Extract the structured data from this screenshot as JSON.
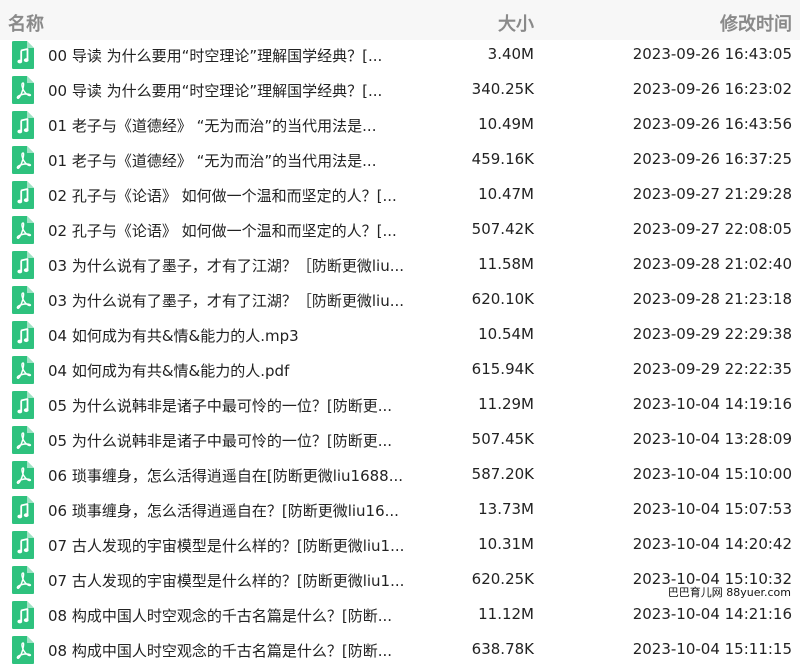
{
  "header": {
    "name_label": "名称",
    "size_label": "大小",
    "time_label": "修改时间"
  },
  "icon_color": "#2ec27e",
  "files": [
    {
      "name": "00 导读 为什么要用“时空理论”理解国学经典？[...",
      "size": "3.40M",
      "time": "2023-09-26 16:43:05",
      "type": "audio",
      "icon": "music-note-icon"
    },
    {
      "name": "00 导读 为什么要用“时空理论”理解国学经典？[...",
      "size": "340.25K",
      "time": "2023-09-26 16:23:02",
      "type": "pdf",
      "icon": "pdf-icon"
    },
    {
      "name": "01 老子与《道德经》 “无为而治”的当代用法是...",
      "size": "10.49M",
      "time": "2023-09-26 16:43:56",
      "type": "audio",
      "icon": "music-note-icon"
    },
    {
      "name": "01 老子与《道德经》 “无为而治”的当代用法是...",
      "size": "459.16K",
      "time": "2023-09-26 16:37:25",
      "type": "pdf",
      "icon": "pdf-icon"
    },
    {
      "name": "02 孔子与《论语》 如何做一个温和而坚定的人？[...",
      "size": "10.47M",
      "time": "2023-09-27 21:29:28",
      "type": "audio",
      "icon": "music-note-icon"
    },
    {
      "name": "02 孔子与《论语》 如何做一个温和而坚定的人？[...",
      "size": "507.42K",
      "time": "2023-09-27 22:08:05",
      "type": "pdf",
      "icon": "pdf-icon"
    },
    {
      "name": "03 为什么说有了墨子，才有了江湖？［防断更微liu...",
      "size": "11.58M",
      "time": "2023-09-28 21:02:40",
      "type": "audio",
      "icon": "music-note-icon"
    },
    {
      "name": "03 为什么说有了墨子，才有了江湖？［防断更微liu...",
      "size": "620.10K",
      "time": "2023-09-28 21:23:18",
      "type": "pdf",
      "icon": "pdf-icon"
    },
    {
      "name": "04 如何成为有共&情&能力的人.mp3",
      "size": "10.54M",
      "time": "2023-09-29 22:29:38",
      "type": "audio",
      "icon": "music-note-icon"
    },
    {
      "name": "04 如何成为有共&情&能力的人.pdf",
      "size": "615.94K",
      "time": "2023-09-29 22:22:35",
      "type": "pdf",
      "icon": "pdf-icon"
    },
    {
      "name": "05 为什么说韩非是诸子中最可怜的一位？[防断更...",
      "size": "11.29M",
      "time": "2023-10-04 14:19:16",
      "type": "audio",
      "icon": "music-note-icon"
    },
    {
      "name": "05 为什么说韩非是诸子中最可怜的一位？[防断更...",
      "size": "507.45K",
      "time": "2023-10-04 13:28:09",
      "type": "pdf",
      "icon": "pdf-icon"
    },
    {
      "name": "06 琐事缠身，怎么活得逍遥自在[防断更微liu1688...",
      "size": "587.20K",
      "time": "2023-10-04 15:10:00",
      "type": "pdf",
      "icon": "pdf-icon"
    },
    {
      "name": "06 琐事缠身，怎么活得逍遥自在？[防断更微liu16...",
      "size": "13.73M",
      "time": "2023-10-04 15:07:53",
      "type": "audio",
      "icon": "music-note-icon"
    },
    {
      "name": "07 古人发现的宇宙模型是什么样的？[防断更微liu1...",
      "size": "10.31M",
      "time": "2023-10-04 14:20:42",
      "type": "audio",
      "icon": "music-note-icon"
    },
    {
      "name": "07 古人发现的宇宙模型是什么样的？[防断更微liu1...",
      "size": "620.25K",
      "time": "2023-10-04 15:10:32",
      "type": "pdf",
      "icon": "pdf-icon"
    },
    {
      "name": "08 构成中国人时空观念的千古名篇是什么？[防断...",
      "size": "11.12M",
      "time": "2023-10-04 14:21:16",
      "type": "audio",
      "icon": "music-note-icon"
    },
    {
      "name": "08 构成中国人时空观念的千古名篇是什么？[防断...",
      "size": "638.78K",
      "time": "2023-10-04 15:11:15",
      "type": "pdf",
      "icon": "pdf-icon"
    }
  ],
  "watermark": "巴巴育儿网 88yuer.com"
}
